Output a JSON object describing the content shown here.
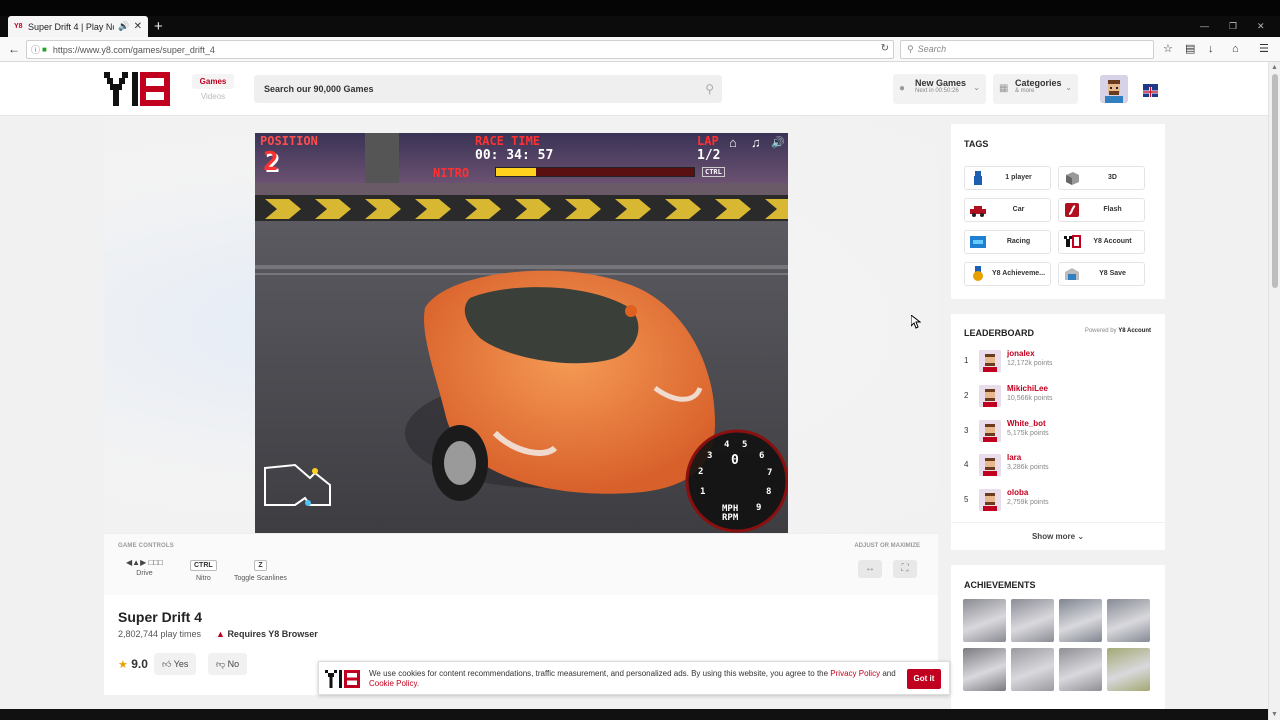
{
  "browser": {
    "tab_title": "Super Drift 4 | Play No...",
    "url": "https://www.y8.com/games/super_drift_4",
    "search_placeholder": "Search"
  },
  "header": {
    "nav_games": "Games",
    "nav_videos": "Videos",
    "search_placeholder": "Search our 90,000 Games",
    "new_games_label": "New Games",
    "new_games_sub": "Next in 00:50:26",
    "categories_label": "Categories",
    "categories_sub": "& more"
  },
  "game": {
    "hud_position_label": "POSITION",
    "hud_position_value": "2",
    "hud_race_time_label": "RACE TIME",
    "hud_race_time": "00: 34: 57",
    "hud_lap_label": "LAP",
    "hud_lap": "1/2",
    "hud_nitro_label": "NITRO",
    "hud_ctrl_label": "CTRL",
    "hud_nitro_fraction": 0.2,
    "speedo_unit_1": "MPH",
    "speedo_unit_2": "RPM",
    "speedo_numbers": [
      "1",
      "2",
      "3",
      "4",
      "5",
      "6",
      "7",
      "8",
      "9"
    ],
    "speedo_value": "0"
  },
  "controls": {
    "title": "GAME CONTROLS",
    "items": [
      {
        "key": "arrows / WASD",
        "label": "Drive"
      },
      {
        "key": "CTRL",
        "label": "Nitro"
      },
      {
        "key": "Z",
        "label": "Toggle Scanlines"
      }
    ],
    "adjust_title": "ADJUST OR MAXIMIZE"
  },
  "info": {
    "title": "Super Drift 4",
    "play_times": "2,802,744 play times",
    "requires": "Requires Y8 Browser",
    "rating": "9.0",
    "yes": "Yes",
    "no": "No"
  },
  "tags": {
    "title": "TAGS",
    "items": [
      {
        "label": "1 player",
        "icon": "player-icon"
      },
      {
        "label": "3D",
        "icon": "cube-icon"
      },
      {
        "label": "Car",
        "icon": "car-icon"
      },
      {
        "label": "Flash",
        "icon": "flash-icon"
      },
      {
        "label": "Racing",
        "icon": "racing-icon"
      },
      {
        "label": "Y8 Account",
        "icon": "y8-account-icon"
      },
      {
        "label": "Y8 Achieveme...",
        "icon": "medal-icon"
      },
      {
        "label": "Y8 Save",
        "icon": "save-icon"
      }
    ]
  },
  "leaderboard": {
    "title": "LEADERBOARD",
    "powered_prefix": "Powered by",
    "powered_brand": "Y8 Account",
    "rows": [
      {
        "rank": "1",
        "name": "jonalex",
        "points": "12,172k points"
      },
      {
        "rank": "2",
        "name": "MikichiLee",
        "points": "10,566k points"
      },
      {
        "rank": "3",
        "name": "White_bot",
        "points": "5,175k points"
      },
      {
        "rank": "4",
        "name": "lara",
        "points": "3,286k points"
      },
      {
        "rank": "5",
        "name": "oloba",
        "points": "2,759k points"
      }
    ],
    "show_more": "Show more"
  },
  "achievements": {
    "title": "ACHIEVEMENTS",
    "colors": [
      "#8a8a92",
      "#8c8c96",
      "#7f8590",
      "#868a94",
      "#7a7a80",
      "#9a9a9f",
      "#8e8e94",
      "#a3a872"
    ]
  },
  "cookie": {
    "text_before": "We use cookies for content recommendations, traffic measurement, and personalized ads. By using this website, you agree to the",
    "privacy": "Privacy Policy",
    "and": "and",
    "cookie_policy": "Cookie Policy.",
    "button": "Got it"
  },
  "colors": {
    "brand_red": "#c0001e",
    "car_orange": "#e8752c"
  }
}
